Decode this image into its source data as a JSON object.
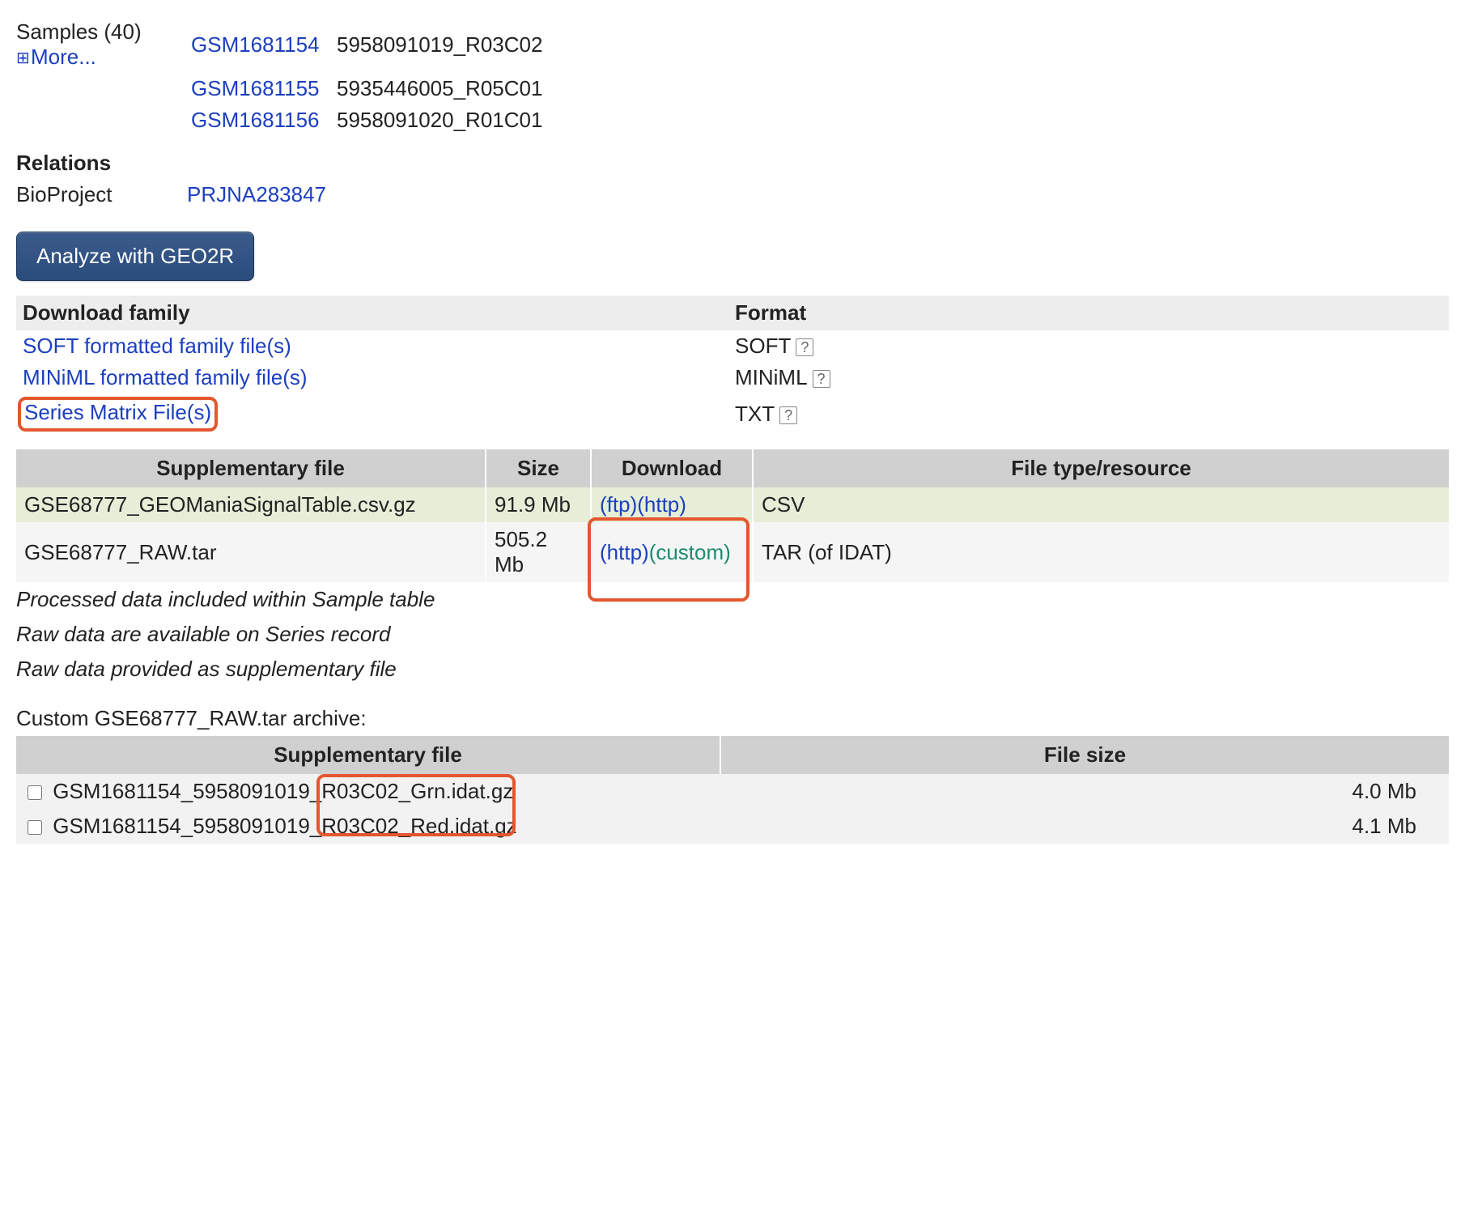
{
  "samples": {
    "label": "Samples (40)",
    "more_label": "More...",
    "rows": [
      {
        "id": "GSM1681154",
        "desc": "5958091019_R03C02"
      },
      {
        "id": "GSM1681155",
        "desc": "5935446005_R05C01"
      },
      {
        "id": "GSM1681156",
        "desc": "5958091020_R01C01"
      }
    ]
  },
  "relations": {
    "heading": "Relations",
    "bioproject_label": "BioProject",
    "bioproject_id": "PRJNA283847"
  },
  "analyze_button": "Analyze with GEO2R",
  "download_family": {
    "col_download": "Download family",
    "col_format": "Format",
    "rows": [
      {
        "link": "SOFT formatted family file(s)",
        "format": "SOFT"
      },
      {
        "link": "MINiML formatted family file(s)",
        "format": "MINiML"
      },
      {
        "link": "Series Matrix File(s)",
        "format": "TXT",
        "highlighted": true
      }
    ]
  },
  "supp": {
    "col_file": "Supplementary file",
    "col_size": "Size",
    "col_download": "Download",
    "col_type": "File type/resource",
    "rows": [
      {
        "file": "GSE68777_GEOManiaSignalTable.csv.gz",
        "size": "91.9 Mb",
        "links": [
          {
            "t": "(ftp)",
            "s": "link"
          },
          {
            "t": "(http)",
            "s": "link"
          }
        ],
        "type": "CSV"
      },
      {
        "file": "GSE68777_RAW.tar",
        "size": "505.2 Mb",
        "links": [
          {
            "t": "(http)",
            "s": "link"
          },
          {
            "t": "(custom)",
            "s": "teal"
          }
        ],
        "type": "TAR (of IDAT)",
        "dl_highlight": true
      }
    ],
    "notes": [
      "Processed data included within Sample table",
      "Raw data are available on Series record",
      "Raw data provided as supplementary file"
    ]
  },
  "custom": {
    "label": "Custom GSE68777_RAW.tar archive:",
    "col_file": "Supplementary file",
    "col_size": "File size",
    "rows": [
      {
        "file_pre": "GSM1681154_5958091019_",
        "file_hi": "R03C02_Grn.idat.gz",
        "size": "4.0 Mb"
      },
      {
        "file_pre": "GSM1681154_5958091019_",
        "file_hi": "R03C02_Red.idat.gz",
        "size": "4.1 Mb"
      }
    ]
  }
}
